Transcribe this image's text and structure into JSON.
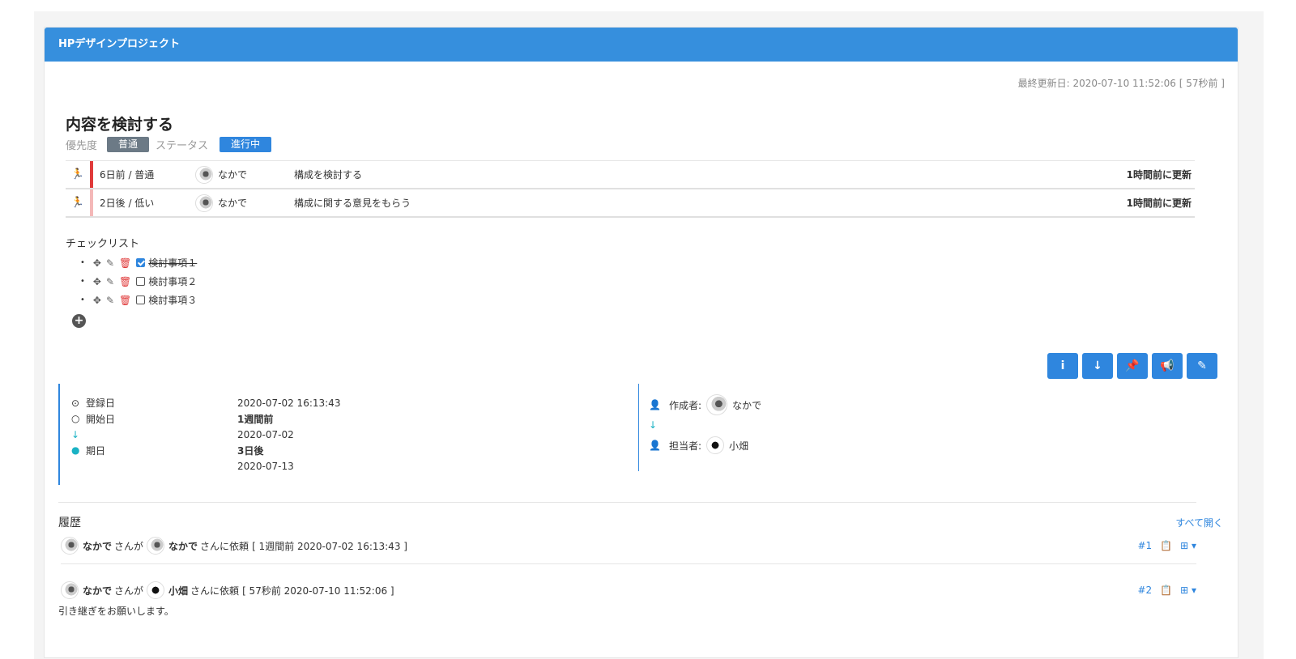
{
  "project": {
    "title": "HPデザインプロジェクト"
  },
  "last_updated": "最終更新日: 2020-07-10 11:52:06 [ 57秒前 ]",
  "task": {
    "title": "内容を検討する",
    "priority_label": "優先度",
    "priority_value": "普通",
    "status_label": "ステータス",
    "status_value": "進行中"
  },
  "subtasks": [
    {
      "due": "6日前 / 普通",
      "user": "なかで",
      "text": "構成を検討する",
      "updated": "1時間前に更新",
      "bar_color": "#e03a3a"
    },
    {
      "due": "2日後 / 低い",
      "user": "なかで",
      "text": "構成に関する意見をもらう",
      "updated": "1時間前に更新",
      "bar_color": "#f4b8b8"
    }
  ],
  "checklist": {
    "heading": "チェックリスト",
    "items": [
      {
        "label": "検討事項１",
        "checked": true
      },
      {
        "label": "検討事項２",
        "checked": false
      },
      {
        "label": "検討事項３",
        "checked": false
      }
    ]
  },
  "dates": {
    "registered_label": "登録日",
    "registered_value": "2020-07-02 16:13:43",
    "start_label": "開始日",
    "start_relative": "1週間前",
    "start_value": "2020-07-02",
    "due_label": "期日",
    "due_relative": "3日後",
    "due_value": "2020-07-13"
  },
  "people": {
    "creator_label": "作成者:",
    "creator_name": "なかで",
    "assignee_label": "担当者:",
    "assignee_name": "小畑"
  },
  "history": {
    "title": "履歴",
    "open_all": "すべて開く",
    "entries": [
      {
        "from": "なかで",
        "from_suffix": "さんが",
        "to": "なかで",
        "to_suffix": "さんに依頼",
        "meta": "[ 1週間前 2020-07-02 16:13:43 ]",
        "num": "#1",
        "comment": ""
      },
      {
        "from": "なかで",
        "from_suffix": "さんが",
        "to": "小畑",
        "to_suffix": "さんに依頼",
        "meta": "[ 57秒前 2020-07-10 11:52:06 ]",
        "num": "#2",
        "comment": "引き継ぎをお願いします。"
      }
    ]
  },
  "colors": {
    "header": "#368fdd",
    "accent": "#2f86de",
    "teal": "#1ab2c4",
    "danger": "#e03a3a"
  },
  "icons": {
    "action_buttons": [
      "info-icon",
      "arrow-down-icon",
      "pin-icon",
      "bullhorn-icon",
      "edit-icon"
    ]
  }
}
